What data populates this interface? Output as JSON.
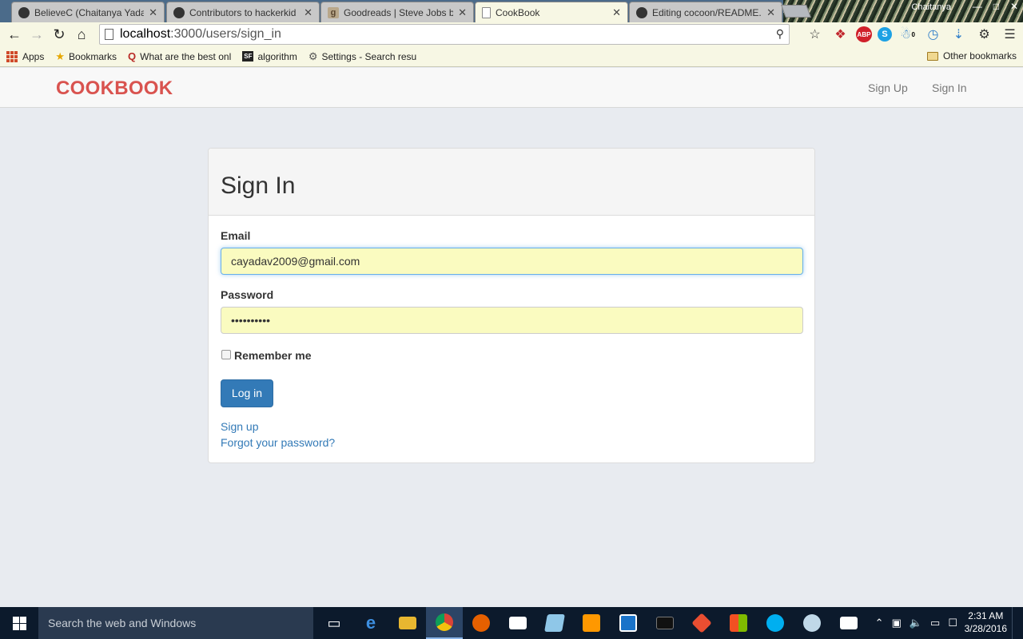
{
  "browser": {
    "tabs": [
      {
        "title": "BelieveC (Chaitanya Yadav",
        "favicon": "github-icon"
      },
      {
        "title": "Contributors to hackerkid",
        "favicon": "github-icon"
      },
      {
        "title": "Goodreads | Steve Jobs by",
        "favicon": "goodreads-icon"
      },
      {
        "title": "CookBook",
        "favicon": "page-icon"
      },
      {
        "title": "Editing cocoon/README.r",
        "favicon": "github-icon"
      }
    ],
    "profile_name": "Chaitanya",
    "url_host": "localhost",
    "url_path": ":3000/users/sign_in",
    "bookmarks": [
      {
        "label": "Apps"
      },
      {
        "label": "Bookmarks"
      },
      {
        "label": "What are the best onl"
      },
      {
        "label": "algorithm"
      },
      {
        "label": "Settings - Search resu"
      }
    ],
    "other_bookmarks": "Other bookmarks",
    "extension_badge": "0",
    "abp_label": "ABP"
  },
  "app": {
    "brand": "COOKBOOK",
    "nav_signup": "Sign Up",
    "nav_signin": "Sign In"
  },
  "form": {
    "title": "Sign In",
    "email_label": "Email",
    "email_value": "cayadav2009@gmail.com",
    "password_label": "Password",
    "password_value": "••••••••••",
    "remember_label": "Remember me",
    "remember_checked": false,
    "submit_label": "Log in",
    "signup_link": "Sign up",
    "forgot_link": "Forgot your password?"
  },
  "taskbar": {
    "search_placeholder": "Search the web and Windows",
    "time": "2:31 AM",
    "date": "3/28/2016"
  },
  "colors": {
    "brand": "#d9534f",
    "primary": "#337ab7",
    "autofill": "#fafbc0",
    "chrome_bar": "#f7f7e4"
  }
}
